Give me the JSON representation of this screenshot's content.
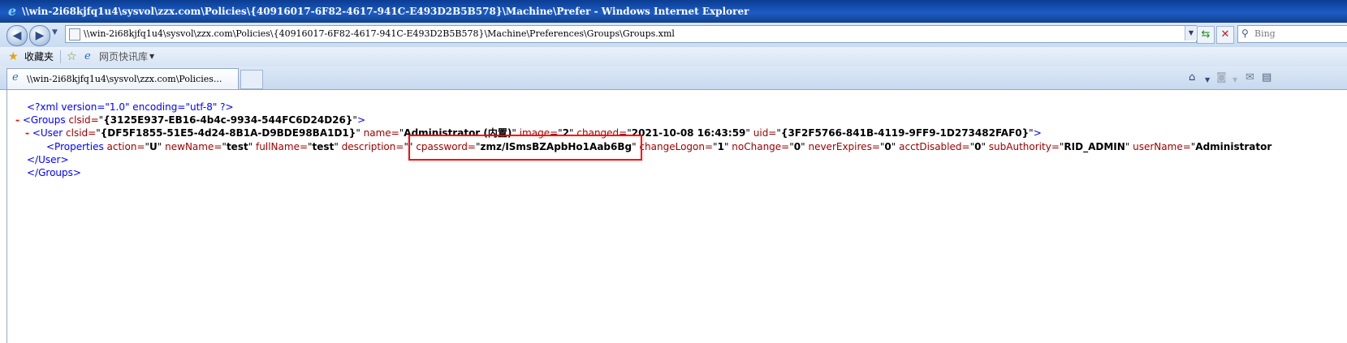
{
  "window": {
    "title": "\\\\win-2i68kjfq1u4\\sysvol\\zzx.com\\Policies\\{40916017-6F82-4617-941C-E493D2B5B578}\\Machine\\Prefer - Windows Internet Explorer"
  },
  "address_bar": {
    "url": "\\\\win-2i68kjfq1u4\\sysvol\\zzx.com\\Policies\\{40916017-6F82-4617-941C-E493D2B5B578}\\Machine\\Preferences\\Groups\\Groups.xml"
  },
  "search": {
    "placeholder": "Bing"
  },
  "favorites_bar": {
    "favorites_label": "收藏夹",
    "web_slice_label": "网页快讯库"
  },
  "tabs": [
    {
      "label": "\\\\win-2i68kjfq1u4\\sysvol\\zzx.com\\Policies..."
    }
  ],
  "icons": {
    "back": "back-arrow-icon",
    "forward": "forward-arrow-icon",
    "refresh": "refresh-icon",
    "stop": "stop-icon",
    "search": "magnifier-icon",
    "favorites": "star-icon",
    "home": "home-icon",
    "feeds": "rss-icon",
    "mail": "mail-icon",
    "print": "print-icon"
  },
  "xml": {
    "declaration": "<?xml version=\"1.0\" encoding=\"utf-8\" ?>",
    "collapse_glyph": "-",
    "groups": {
      "open": "<Groups",
      "clsid_attr": " clsid=",
      "clsid_value": "{3125E937-EB16-4b4c-9934-544FC6D24D26}",
      "close_bracket": ">",
      "end_tag": "</Groups>"
    },
    "user": {
      "open": "<User",
      "clsid_attr": " clsid=",
      "clsid_value": "{DF5F1855-51E5-4d24-8B1A-D9BDE98BA1D1}",
      "name_attr": " name=",
      "name_value": "Administrator (内置)",
      "image_attr": " image=",
      "image_value": "2",
      "changed_attr": " changed=",
      "changed_value": "2021-10-08 16:43:59",
      "uid_attr": " uid=",
      "uid_value": "{3F2F5766-841B-4119-9FF9-1D273482FAF0}",
      "close_bracket": ">",
      "end_tag": "</User>"
    },
    "properties": {
      "open": "<Properties",
      "action_attr": " action=",
      "action_value": "U",
      "newName_attr": " newName=",
      "newName_value": "test",
      "fullName_attr": " fullName=",
      "fullName_value": "test",
      "description_attr": " description=",
      "description_value": "",
      "cpassword_attr": " cpassword=",
      "cpassword_value": "zmz/ISmsBZApbHo1Aab6Bg",
      "changeLogon_attr": " changeLogon=",
      "changeLogon_value": "1",
      "noChange_attr": " noChange=",
      "noChange_value": "0",
      "neverExpires_attr": " neverExpires=",
      "neverExpires_value": "0",
      "acctDisabled_attr": " acctDisabled=",
      "acctDisabled_value": "0",
      "subAuthority_attr": " subAuthority=",
      "subAuthority_value": "RID_ADMIN",
      "userName_attr": " userName=",
      "userName_value": "Administrator"
    }
  },
  "colors": {
    "highlight_box": "#ff0000",
    "xml_tag": "#990000",
    "xml_markup": "#0000ff"
  }
}
